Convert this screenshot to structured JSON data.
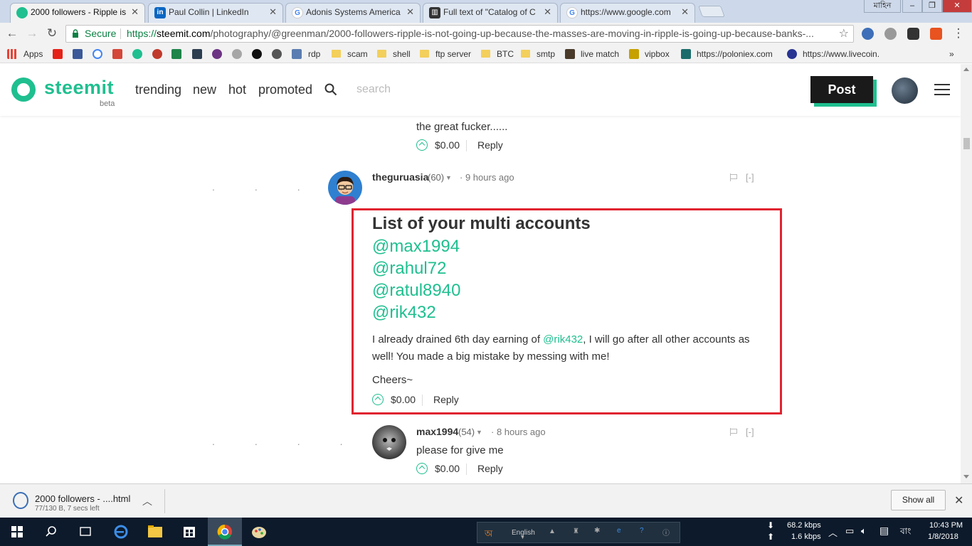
{
  "browser": {
    "tabs": [
      {
        "title": "2000 followers - Ripple is",
        "icon": "steemit-icon",
        "color": "#1fbf8f",
        "active": true
      },
      {
        "title": "Paul Collin | LinkedIn",
        "icon": "linkedin-icon",
        "color": "#0a66c2",
        "active": false
      },
      {
        "title": "Adonis Systems America",
        "icon": "google-icon",
        "color": "#4285f4",
        "active": false
      },
      {
        "title": "Full text of \"Catalog of C",
        "icon": "archive-icon",
        "color": "#333333",
        "active": false
      },
      {
        "title": "https://www.google.com",
        "icon": "google-icon",
        "color": "#4285f4",
        "active": false
      }
    ],
    "user_label": "মাহিন",
    "secure_label": "Secure",
    "url_scheme": "https://",
    "url_host": "steemit.com",
    "url_path": "/photography/@greenman/2000-followers-ripple-is-not-going-up-because-the-masses-are-moving-in-ripple-is-going-up-because-banks-..."
  },
  "bookmarks": [
    {
      "label": "Apps",
      "type": "apps"
    },
    {
      "label": "",
      "type": "youtube"
    },
    {
      "label": "",
      "type": "facebook"
    },
    {
      "label": "",
      "type": "google"
    },
    {
      "label": "",
      "type": "gmail"
    },
    {
      "label": "",
      "type": "steemit"
    },
    {
      "label": "rdp",
      "type": "link"
    },
    {
      "label": "scam",
      "type": "folder"
    },
    {
      "label": "shell",
      "type": "folder"
    },
    {
      "label": "ftp server",
      "type": "folder"
    },
    {
      "label": "BTC",
      "type": "folder"
    },
    {
      "label": "smtp",
      "type": "folder"
    },
    {
      "label": "live match",
      "type": "link"
    },
    {
      "label": "vipbox",
      "type": "link"
    },
    {
      "label": "https://poloniex.com",
      "type": "link"
    },
    {
      "label": "https://www.livecoin.",
      "type": "link"
    }
  ],
  "site": {
    "logo": "steemit",
    "beta": "beta",
    "nav": [
      "trending",
      "new",
      "hot",
      "promoted"
    ],
    "search_placeholder": "search",
    "post_label": "Post"
  },
  "comments": {
    "prev": {
      "text": "the great fucker......",
      "payout": "$0.00",
      "reply": "Reply"
    },
    "main": {
      "author": "theguruasia",
      "rep": "(60)",
      "time": "9 hours ago",
      "collapse": "[-]",
      "heading": "List of your multi accounts",
      "mentions": [
        "@max1994",
        "@rahul72",
        "@ratul8940",
        "@rik432"
      ],
      "para1_before": "I already drained 6th day earning of ",
      "para1_link": "@rik432",
      "para1_after": ", I will go after all other accounts as well! You made a big mistake by messing with me!",
      "para2": "Cheers~",
      "payout": "$0.00",
      "reply": "Reply"
    },
    "child": {
      "author": "max1994",
      "rep": "(54)",
      "time": "8 hours ago",
      "collapse": "[-]",
      "text": "please for give me",
      "payout": "$0.00",
      "reply": "Reply"
    }
  },
  "download": {
    "name": "2000 followers - ....html",
    "sub": "77/130 B, 7 secs left",
    "show_all": "Show all"
  },
  "taskbar": {
    "lang": "English",
    "net_down": "68.2 kbps",
    "net_up": "1.6 kbps",
    "ime": "বাং",
    "time": "10:43 PM",
    "date": "1/8/2018"
  },
  "colors": {
    "accent": "#1fbf8f",
    "highlight": "#e02430"
  }
}
